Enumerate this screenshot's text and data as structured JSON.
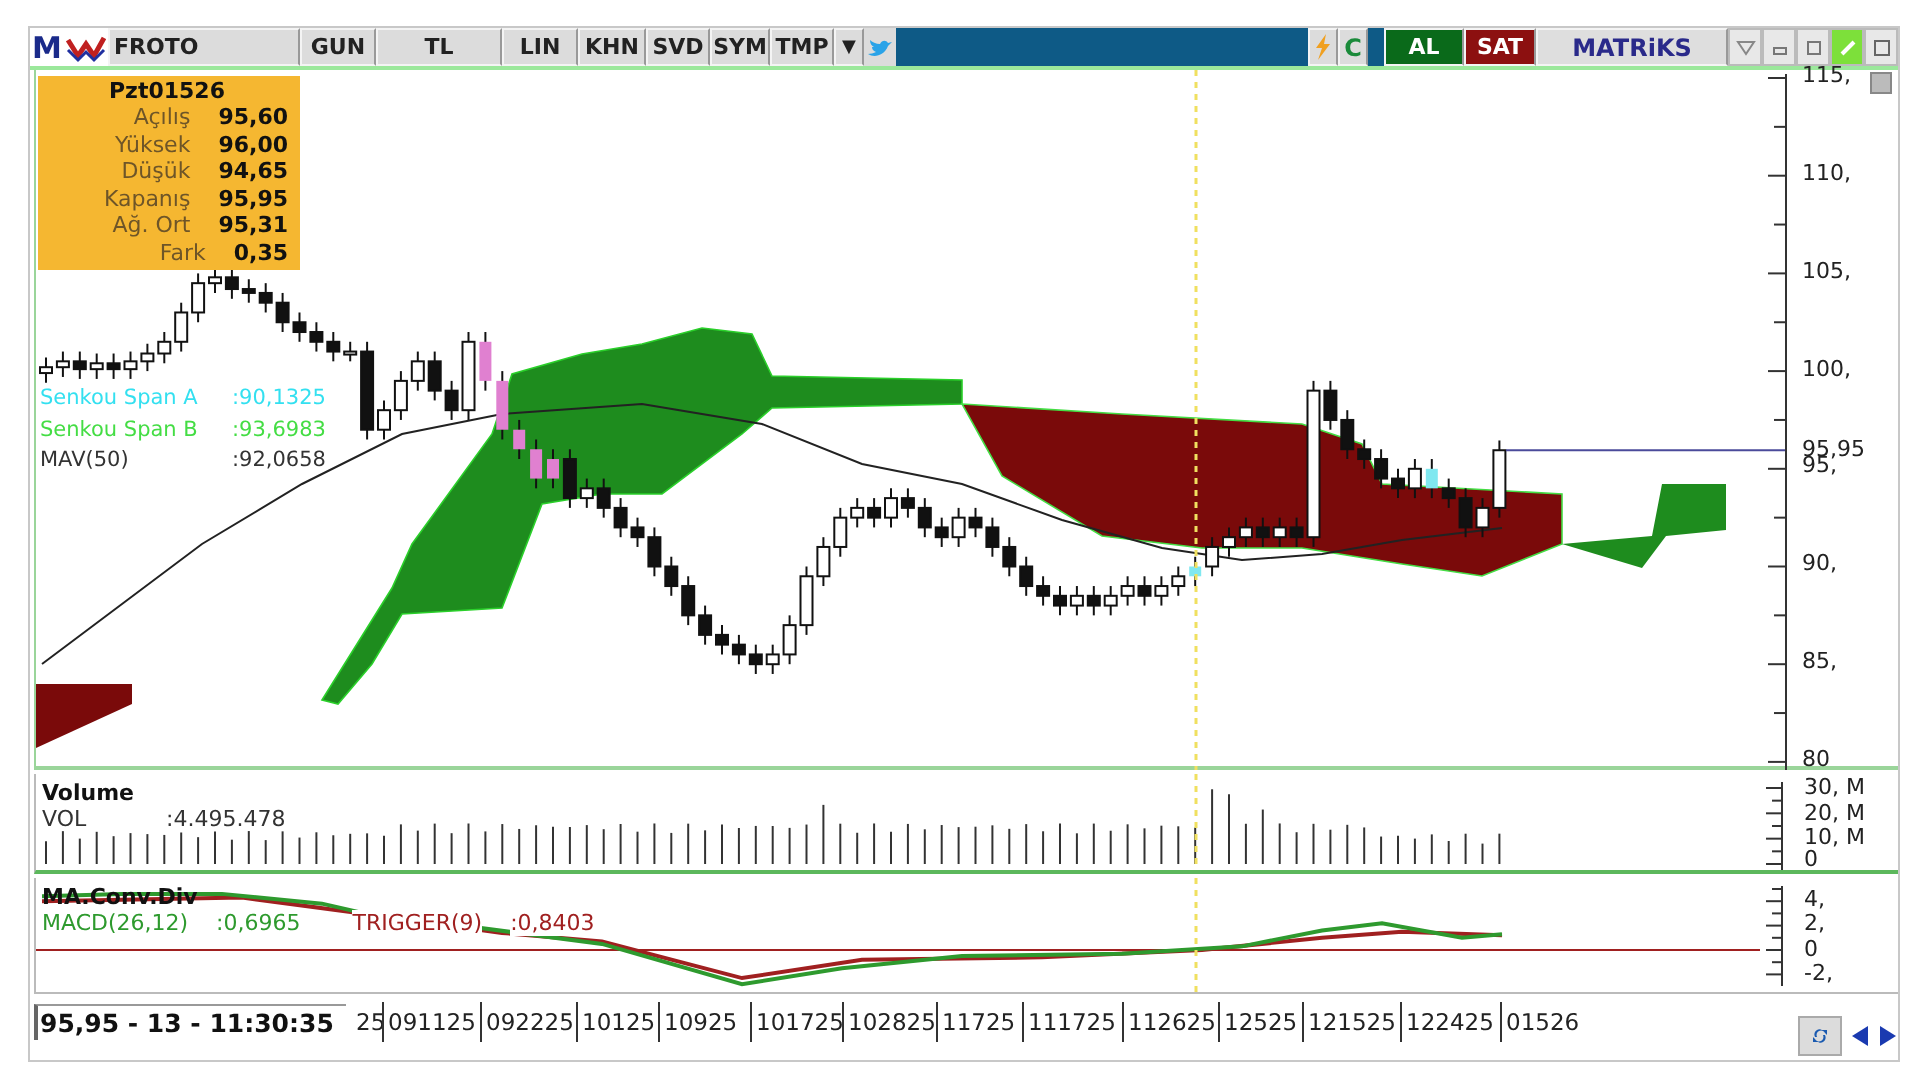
{
  "toolbar": {
    "logo": "M",
    "symbol": "FROTO",
    "buttons": [
      "GUN",
      "TL",
      "LIN",
      "KHN",
      "SVD",
      "SYM",
      "TMP"
    ],
    "dropdown": "▼",
    "refresh": "C",
    "buy": "AL",
    "sell": "SAT",
    "brand": "MATRiKS"
  },
  "info_box": {
    "title": "Pzt01526",
    "rows": [
      {
        "label": "Açılış",
        "value": "95,60"
      },
      {
        "label": "Yüksek",
        "value": "96,00"
      },
      {
        "label": "Düşük",
        "value": "94,65"
      },
      {
        "label": "Kapanış",
        "value": "95,95"
      },
      {
        "label": "Ağ. Ort",
        "value": "95,31"
      },
      {
        "label": "Fark",
        "value": "0,35"
      }
    ]
  },
  "price_pane": {
    "legend": [
      {
        "label": "Senkou Span A",
        "value": ":90,1325",
        "color": "#33e0f0"
      },
      {
        "label": "Senkou Span B",
        "value": ":93,6983",
        "color": "#44dd44"
      },
      {
        "label": "MAV(50)",
        "value": ":92,0658",
        "color": "#333333"
      }
    ],
    "axis_labels": [
      "115,",
      "110,",
      "105,",
      "100,",
      "95,",
      "90,",
      "85,",
      "80"
    ],
    "last_price": "95,95"
  },
  "volume_pane": {
    "title": "Volume",
    "legend": {
      "label": "VOL",
      "value": ":4.495.478"
    },
    "axis_labels": [
      "30, M",
      "20, M",
      "10, M",
      "0"
    ]
  },
  "macd_pane": {
    "title": "MA.Conv.Div",
    "legend": [
      {
        "label": "MACD(26,12)",
        "value": ":0,6965",
        "color": "#2e9a2e"
      },
      {
        "label": "TRIGGER(9)",
        "value": ":0,8403",
        "color": "#a02020"
      }
    ],
    "axis_labels": [
      "4,",
      "2,",
      "0",
      "-2,"
    ]
  },
  "status": {
    "readout": "95,95 - 13 - 11:30:35",
    "dates": [
      "25",
      "091125",
      "092225",
      "10125",
      "10925",
      "101725",
      "102825",
      "11725",
      "111725",
      "112625",
      "12525",
      "121525",
      "122425",
      "01526"
    ]
  }
}
